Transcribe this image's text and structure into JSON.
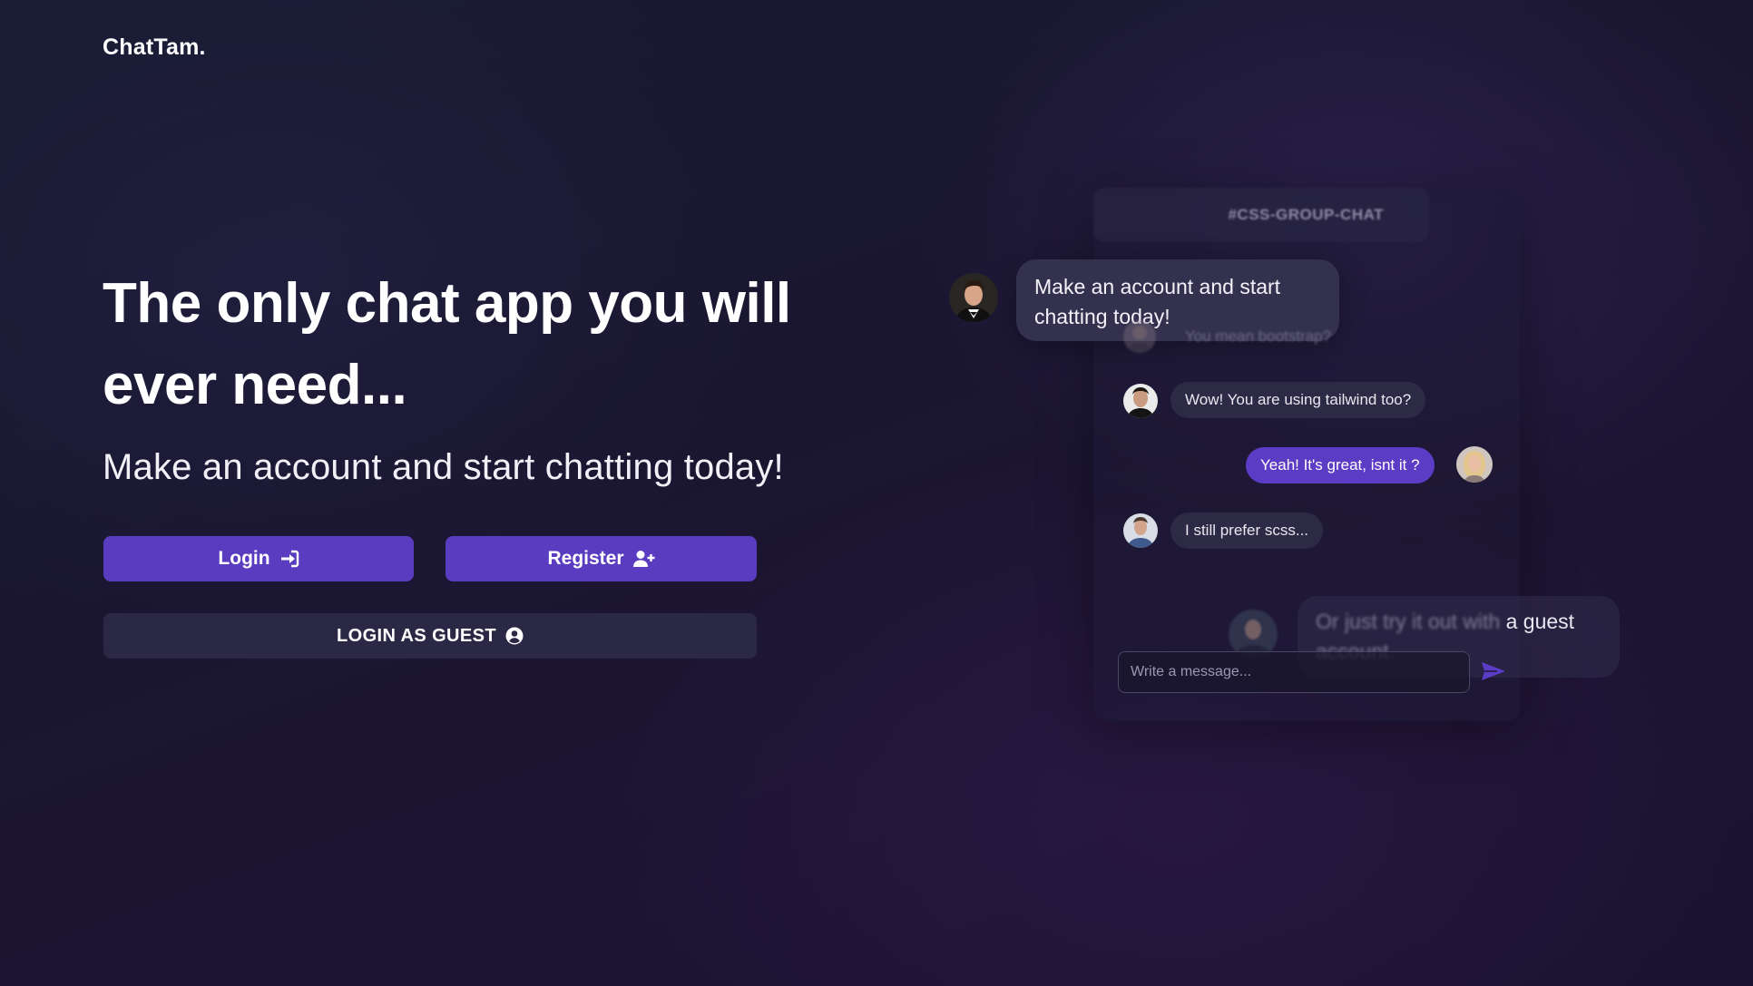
{
  "app": {
    "logo": "ChatTam."
  },
  "hero": {
    "title": "The only chat app you will ever need...",
    "subtitle": "Make an account and start chatting today!"
  },
  "actions": {
    "login_label": "Login",
    "register_label": "Register",
    "guest_label": "LOGIN AS GUEST"
  },
  "chat_preview": {
    "channel": "#CSS-GROUP-CHAT",
    "hero_message": "Make an account and start chatting today!",
    "faded_message": "You mean bootstrap?",
    "messages": [
      {
        "text": "Wow! You are using tailwind too?",
        "side": "left"
      },
      {
        "text": "Yeah! It's great, isnt it ?",
        "side": "right"
      },
      {
        "text": "I still prefer scss...",
        "side": "left"
      }
    ],
    "guest_message_blurred": "Or just try it out with",
    "guest_message_clear": "a guest",
    "guest_message_tail": "account.",
    "input_placeholder": "Write a message..."
  },
  "colors": {
    "accent": "#5a3cc1",
    "guest_button": "#2a2845",
    "background": "#1a1630"
  },
  "icons": {
    "login": "sign-in-icon",
    "register": "user-plus-icon",
    "guest": "user-circle-icon",
    "send": "send-icon"
  }
}
